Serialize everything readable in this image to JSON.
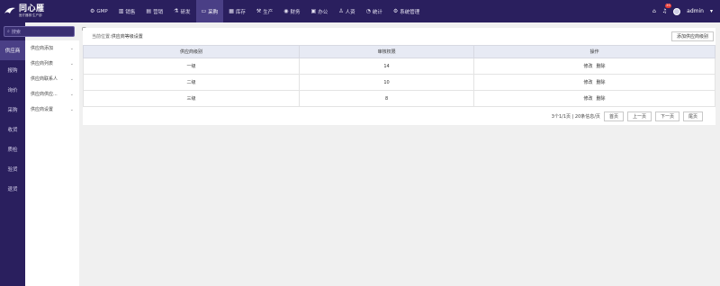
{
  "brand": {
    "title": "同心雁",
    "subtitle": "医疗器械·生产部"
  },
  "nav": [
    {
      "label": "GMP",
      "icon": "gear-icon",
      "glyph": "⚙"
    },
    {
      "label": "销售",
      "icon": "bar-chart-icon",
      "glyph": "▥"
    },
    {
      "label": "营销",
      "icon": "chart-icon",
      "glyph": "▤"
    },
    {
      "label": "研发",
      "icon": "flask-icon",
      "glyph": "⚗"
    },
    {
      "label": "采购",
      "icon": "cart-icon",
      "glyph": "▭",
      "active": true
    },
    {
      "label": "库存",
      "icon": "box-icon",
      "glyph": "▦"
    },
    {
      "label": "生产",
      "icon": "factory-icon",
      "glyph": "⚒"
    },
    {
      "label": "财务",
      "icon": "money-icon",
      "glyph": "◉"
    },
    {
      "label": "办公",
      "icon": "briefcase-icon",
      "glyph": "▣"
    },
    {
      "label": "人资",
      "icon": "user-icon",
      "glyph": "♙"
    },
    {
      "label": "统计",
      "icon": "stats-icon",
      "glyph": "◔"
    },
    {
      "label": "系统管理",
      "icon": "settings-icon",
      "glyph": "⚙"
    }
  ],
  "topright": {
    "user": "admin",
    "badge": "20"
  },
  "search": {
    "placeholder": "搜索"
  },
  "leftcol": [
    "供应商",
    "报购",
    "询价",
    "采购",
    "收货",
    "质检",
    "验货",
    "退货"
  ],
  "subcol": [
    "供应商添加",
    "供应商列表",
    "供应商联系人",
    "供应商供应...",
    "供应商设置"
  ],
  "breadcrumb": {
    "prefix": "当前位置:",
    "current": "供应商等级设置"
  },
  "add_button": "添加供应商级别",
  "table": {
    "headers": [
      "供应商级别",
      "审核权限",
      "操作"
    ],
    "rows": [
      {
        "level": "一级",
        "perm": "14",
        "edit": "修改",
        "del": "删除"
      },
      {
        "level": "二级",
        "perm": "10",
        "edit": "修改",
        "del": "删除"
      },
      {
        "level": "三级",
        "perm": "8",
        "edit": "修改",
        "del": "删除"
      }
    ]
  },
  "pager": {
    "info": "3个1/1页 | 20条信息/页",
    "first": "首页",
    "prev": "上一页",
    "next": "下一页",
    "last": "尾页"
  },
  "colors": {
    "topbar": "#2a1f5e",
    "active": "#4a3f86",
    "header_bg": "#e7eaf4"
  }
}
